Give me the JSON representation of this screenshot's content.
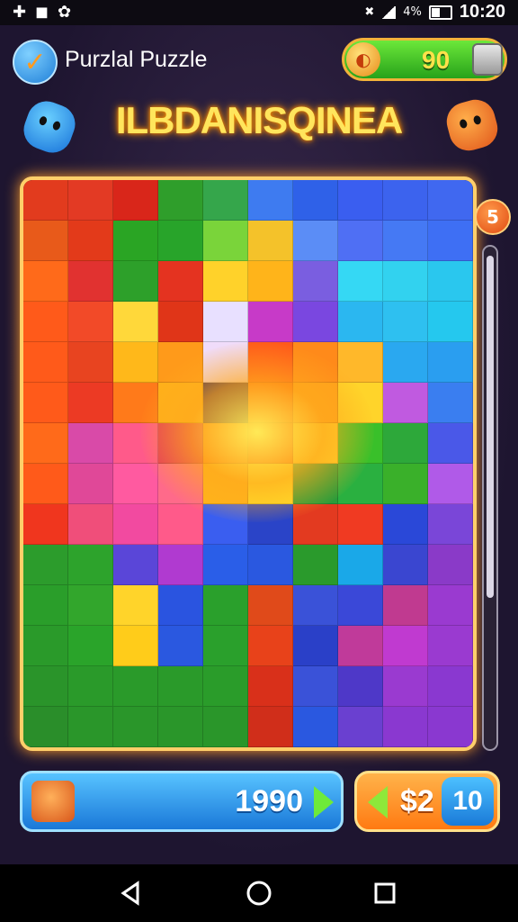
{
  "status_bar": {
    "battery": "4%",
    "time": "10:20"
  },
  "header": {
    "app_title": "Purzlal Puzzle",
    "coins": "90"
  },
  "banner": {
    "title": "ILBDANISQINEA"
  },
  "board": {
    "level_badge": "5",
    "rows": [
      [
        "#e23b1e",
        "#e33a24",
        "#d9261a",
        "#2f9e2b",
        "#35a64b",
        "#3e7bf0",
        "#2f61e8",
        "#3a5ef0",
        "#3c63ee",
        "#4068f0"
      ],
      [
        "#e85a1a",
        "#e33a1a",
        "#2aa524",
        "#28a42a",
        "#7ad43a",
        "#f4c22a",
        "#5b8df6",
        "#4f6ff4",
        "#4579f4",
        "#3e6ff4"
      ],
      [
        "#ff6a1a",
        "#e13230",
        "#2da02a",
        "#e43320",
        "#ffd22a",
        "#ffb41a",
        "#7a5ee0",
        "#35d8f4",
        "#32d2ef",
        "#2ac7ee"
      ],
      [
        "#ff5a1a",
        "#f24a28",
        "#ffd83a",
        "#e03518",
        "#e8e0ff",
        "#c73ac8",
        "#7a47e0",
        "#2bb7f0",
        "#2ec0f0",
        "#25c8ee"
      ],
      [
        "#ff5a1a",
        "#e84420",
        "#ffb81a",
        "#ff9a1a",
        "#f0dcfa",
        "#ff5a1a",
        "#ff8a1a",
        "#ffb82a",
        "#2aa8f0",
        "#2a9ef0"
      ],
      [
        "#ff5a1a",
        "#ec3a24",
        "#ff7a1a",
        "#ffb01a",
        "#2a1e5a",
        "#ff6a12",
        "#ffa01a",
        "#ffd42a",
        "#c05ae0",
        "#3a7ef0"
      ],
      [
        "#ff6a1a",
        "#d94aa8",
        "#ff5a8a",
        "#e43c5a",
        "#ff8a1a",
        "#ff6a12",
        "#ffd02a",
        "#39c02a",
        "#2da83a",
        "#4a58e8"
      ],
      [
        "#ff5a1a",
        "#e04898",
        "#ff5aa0",
        "#ff6a8a",
        "#ffb41a",
        "#ffe02a",
        "#2a9c3a",
        "#2ab040",
        "#3ab02a",
        "#b05ae8"
      ],
      [
        "#f0361e",
        "#f04e7a",
        "#f24aa0",
        "#ff5a8a",
        "#3a5ef0",
        "#2a44c8",
        "#e33a20",
        "#f03a22",
        "#2a48d8",
        "#7a46d8"
      ],
      [
        "#2c9c2c",
        "#2da32c",
        "#5a46d8",
        "#b03ad0",
        "#2a5ee8",
        "#2a58e0",
        "#2a9a2c",
        "#1aa8e8",
        "#3a46d0",
        "#8a3ac8"
      ],
      [
        "#2a9e2a",
        "#32a62c",
        "#ffd42a",
        "#2a54e0",
        "#2aa02c",
        "#e04a1a",
        "#3a52d8",
        "#3a48d8",
        "#c03a90",
        "#9a3ad0"
      ],
      [
        "#2a9a2a",
        "#2aa42a",
        "#ffcc1a",
        "#2a58e0",
        "#2aa02c",
        "#e8421a",
        "#2a40c8",
        "#c03a9a",
        "#c03ad0",
        "#9a3ad0"
      ],
      [
        "#2a942a",
        "#2a9a2a",
        "#2a9a2a",
        "#2a9a2a",
        "#2a9c2a",
        "#d9301a",
        "#3a52d8",
        "#4e38c8",
        "#9a3ad0",
        "#8a38d0"
      ],
      [
        "#2a8e2a",
        "#2a962a",
        "#2a962a",
        "#2a962a",
        "#2a962a",
        "#d02e1a",
        "#2a58e0",
        "#6a40d0",
        "#8a38d0",
        "#8a38d0"
      ]
    ]
  },
  "score_panel": {
    "score": "1990"
  },
  "buy_button": {
    "price": "$2",
    "count": "10"
  }
}
